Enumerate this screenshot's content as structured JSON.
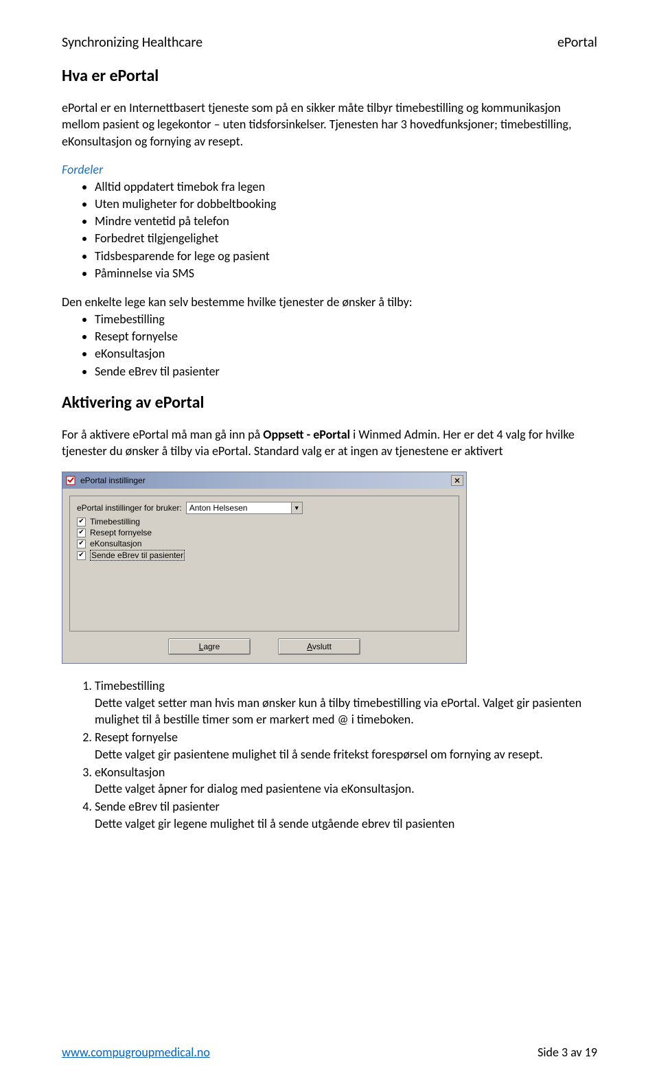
{
  "header": {
    "left": "Synchronizing Healthcare",
    "right": "ePortal"
  },
  "sec1": {
    "title": "Hva er ePortal",
    "intro": "ePortal er en Internettbasert tjeneste som på en sikker måte tilbyr timebestilling og kommunikasjon mellom pasient og legekontor – uten tidsforsinkelser. Tjenesten har 3 hovedfunksjoner; timebestilling, eKonsultasjon og fornying av resept.",
    "benefits_head": "Fordeler",
    "benefits": [
      "Alltid oppdatert timebok fra legen",
      "Uten muligheter for dobbeltbooking",
      "Mindre ventetid på telefon",
      "Forbedret tilgjengelighet",
      "Tidsbesparende for lege og pasient",
      "Påminnelse via SMS"
    ],
    "services_lead": "Den enkelte lege kan selv bestemme hvilke tjenester de ønsker å tilby:",
    "services": [
      "Timebestilling",
      "Resept fornyelse",
      "eKonsultasjon",
      "Sende eBrev til pasienter"
    ]
  },
  "sec2": {
    "title": "Aktivering av ePortal",
    "para_pre": "For å aktivere ePortal må man gå inn på ",
    "para_bold": "Oppsett - ePortal",
    "para_post": " i Winmed Admin. Her er det 4 valg for hvilke tjenester du ønsker å tilby via ePortal. Standard valg er at ingen av tjenestene er aktivert"
  },
  "dialog": {
    "title": "ePortal instillinger",
    "user_label": "ePortal instillinger for bruker:",
    "user_value": "Anton Helsesen",
    "chk1": "Timebestilling",
    "chk2": "Resept fornyelse",
    "chk3": "eKonsultasjon",
    "chk4": "Sende eBrev til pasienter",
    "btn_save_u": "L",
    "btn_save_rest": "agre",
    "btn_cancel_u": "A",
    "btn_cancel_rest": "vslutt"
  },
  "numlist": [
    {
      "head": "Timebestilling",
      "body": "Dette valget setter man hvis man ønsker kun å tilby timebestilling via ePortal. Valget gir pasienten mulighet til å bestille timer som er markert med @ i timeboken."
    },
    {
      "head": "Resept fornyelse",
      "body": "Dette valget gir pasientene mulighet til å sende fritekst forespørsel om fornying av resept."
    },
    {
      "head": "eKonsultasjon",
      "body": "Dette valget åpner for dialog med pasientene via eKonsultasjon."
    },
    {
      "head": "Sende eBrev til pasienter",
      "body": "Dette valget gir legene mulighet til å sende utgående ebrev til pasienten"
    }
  ],
  "footer": {
    "link": "www.compugroupmedical.no",
    "page": "Side 3 av 19"
  }
}
